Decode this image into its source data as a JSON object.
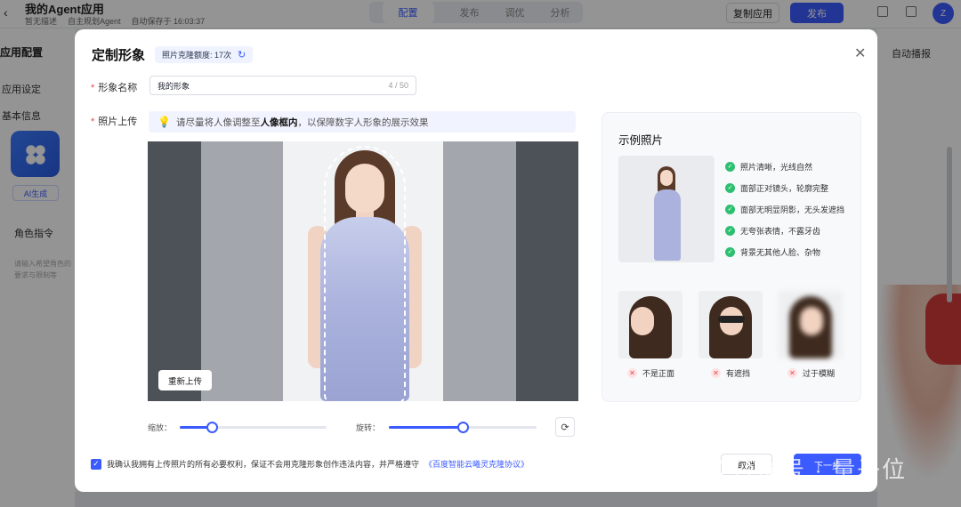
{
  "topbar": {
    "app_title": "我的Agent应用",
    "desc": "暂无描述",
    "agent_type": "自主规划Agent",
    "autosave": "自动保存于 16:03:37",
    "tabs": [
      "配置",
      "发布",
      "调优",
      "分析"
    ],
    "copy_label": "复制应用",
    "publish_label": "发布",
    "avatar_letter": "Z"
  },
  "left_panel": {
    "title": "应用配置",
    "items": [
      "应用设定",
      "基本信息",
      "角色指令"
    ],
    "ai_generate": "AI生成",
    "hint": "请输入希望角色的要求与限制等"
  },
  "right_panel": {
    "label": "自动播报"
  },
  "modal": {
    "title": "定制形象",
    "quota": "照片克隆额度: 17次",
    "name_label": "形象名称",
    "name_value": "我的形象",
    "name_count": "4 / 50",
    "upload_label": "照片上传",
    "tip_pre": "请尽量将人像调整至",
    "tip_bold": "人像框内",
    "tip_post": "，以保障数字人形象的展示效果",
    "reupload": "重新上传",
    "zoom_label": "缩放：",
    "rotate_label": "旋转：",
    "zoom_value": 0.22,
    "rotate_value": 0.5,
    "agree_text": "我确认我拥有上传照片的所有必要权利，保证不会用克隆形象创作违法内容，并严格遵守",
    "agree_link": "《百度智能云曦灵克隆协议》",
    "cancel": "取消",
    "next": "下一步"
  },
  "sample": {
    "title": "示例照片",
    "requirements": [
      "照片清晰，光线自然",
      "面部正对镜头，轮廓完整",
      "面部无明显阴影，无头发遮挡",
      "无夸张表情，不露牙齿",
      "背景无其他人脸、杂物"
    ],
    "bad_examples": [
      "不是正面",
      "有遮挡",
      "过于模糊"
    ]
  },
  "watermark": "公众号 · 量子位",
  "colors": {
    "accent": "#3b5bff",
    "ok": "#2fbf71",
    "error": "#e5484d"
  }
}
